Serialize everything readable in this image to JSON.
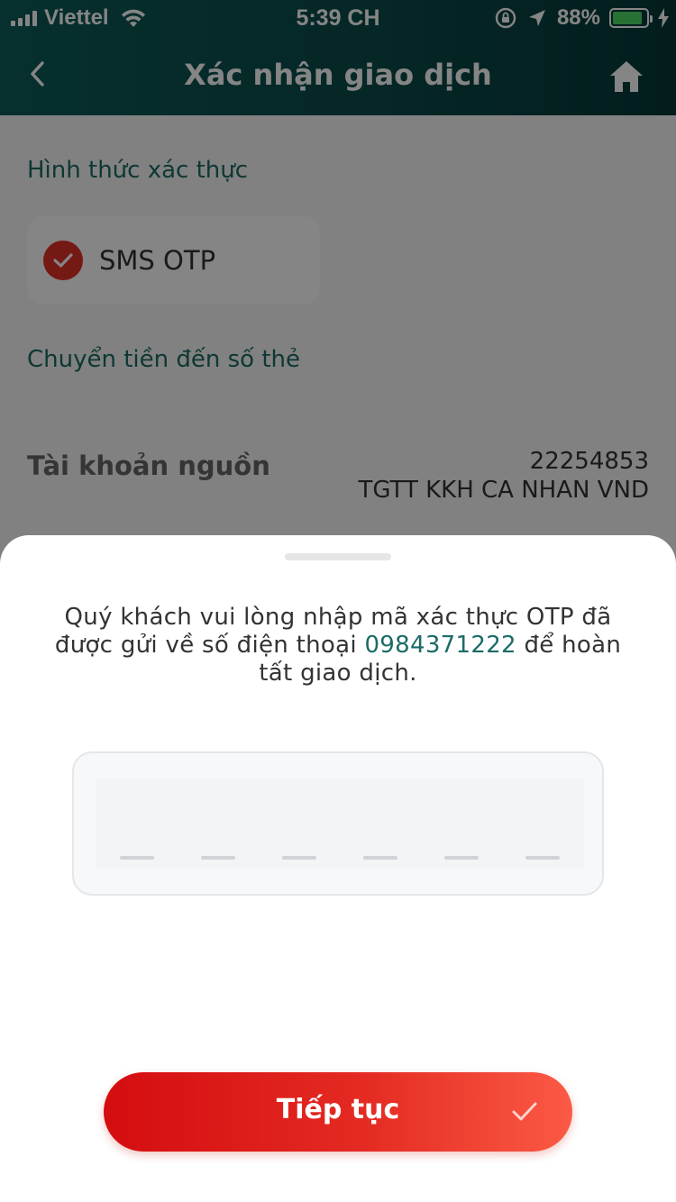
{
  "status_bar": {
    "carrier": "Viettel",
    "time": "5:39 CH",
    "battery_percent": "88%",
    "battery_level": 0.88
  },
  "nav": {
    "title": "Xác nhận giao dịch",
    "back_icon": "chevron-left-icon",
    "home_icon": "home-icon"
  },
  "page": {
    "auth_method_label": "Hình thức xác thực",
    "auth_method_option": "SMS OTP",
    "transfer_label": "Chuyển tiền đến số thẻ",
    "source_account_label": "Tài khoản nguồn",
    "source_account_number": "22254853",
    "source_account_name": "TGTT KKH CA NHAN VND"
  },
  "sheet": {
    "message_prefix": "Quý khách vui lòng nhập mã xác thực OTP đã được gửi về số điện thoại ",
    "phone_number": "0984371222",
    "message_suffix": " để hoàn tất giao dịch.",
    "otp_length": 6,
    "otp_value": "",
    "continue_label": "Tiếp tục"
  },
  "colors": {
    "header_teal": "#0a4c4a",
    "accent_teal": "#1b6b66",
    "primary_red": "#e42a22",
    "battery_green": "#4cd964"
  }
}
